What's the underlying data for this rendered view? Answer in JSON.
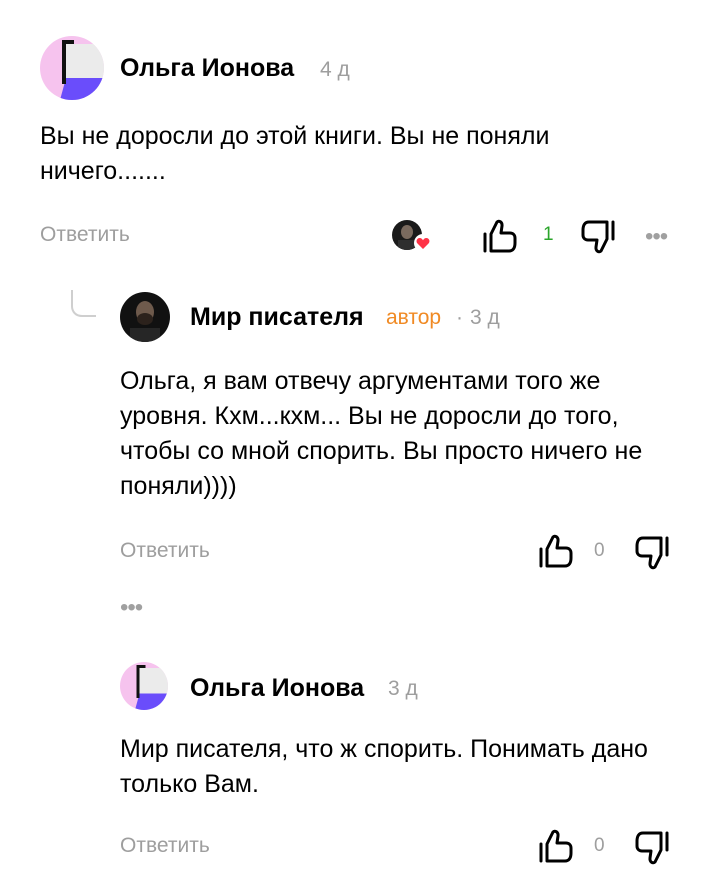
{
  "comments": [
    {
      "author": "Ольга Ионова",
      "time": "4 д",
      "text": "Вы не доросли до этой книги. Вы не поняли ничего.......",
      "reply_label": "Ответить",
      "likes": "1",
      "more": "•••"
    },
    {
      "author": "Мир писателя",
      "badge": "автор",
      "separator": "·",
      "time": "3 д",
      "text": "Ольга, я вам отвечу аргументами того же уровня. Кхм...кхм... Вы не доросли до того, чтобы со мной спорить. Вы просто ничего не поняли))))",
      "reply_label": "Ответить",
      "likes": "0"
    },
    {
      "author": "Ольга Ионова",
      "time": "3 д",
      "text": "Мир писателя, что ж спорить. Понимать дано только Вам.",
      "reply_label": "Ответить",
      "likes": "0"
    }
  ],
  "collapsed_replies": "•••",
  "colors": {
    "author_badge": "#f08a24",
    "positive_count": "#2aa52a",
    "muted": "#9e9e9e"
  }
}
